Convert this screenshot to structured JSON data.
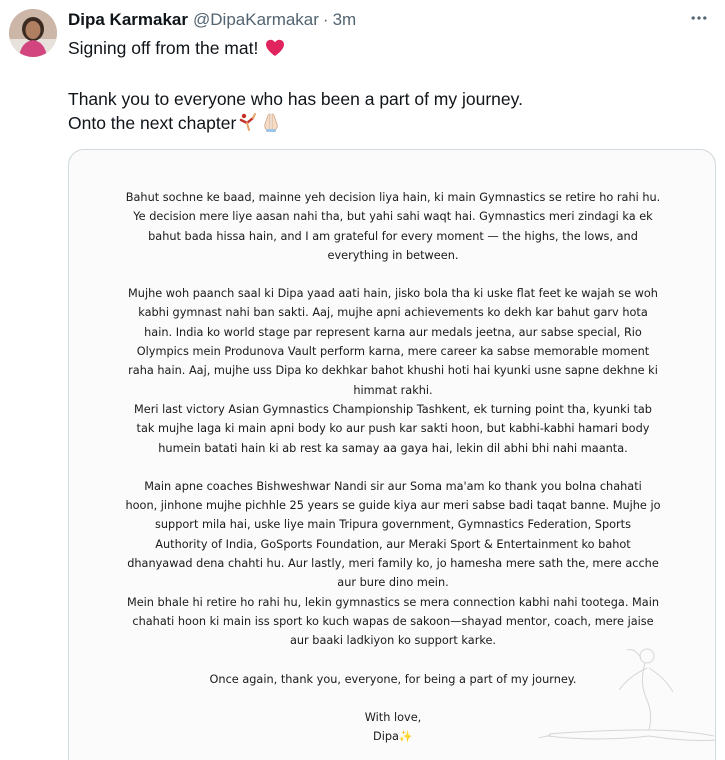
{
  "tweet": {
    "author": {
      "display_name": "Dipa Karmakar",
      "handle": "@DipaKarmakar",
      "separator": "·",
      "timestamp": "3m"
    },
    "more_icon": "ellipsis-icon",
    "text_lines": [
      "Signing off from the mat!",
      "",
      "Thank you to everyone who has been a part of my journey.",
      "Onto the next chapter"
    ],
    "emojis": {
      "heart": "❤️",
      "gymnast": "🤸",
      "folded_hands": "🙏🏻"
    },
    "colors": {
      "name": "#0f1419",
      "secondary": "#536471",
      "border": "#cfd9de",
      "heart": "#e0245e"
    }
  },
  "letter": {
    "paragraphs": [
      [
        "Bahut sochne ke baad, mainne yeh decision liya hain, ki main Gymnastics se retire ho rahi hu.",
        "Ye decision mere liye aasan nahi tha, but yahi sahi waqt hai. Gymnastics meri zindagi ka ek",
        "bahut bada hissa hain, and I am grateful for every moment — the highs, the lows, and",
        "everything in between."
      ],
      [
        "Mujhe woh paanch saal ki Dipa yaad aati hain, jisko bola tha ki uske flat feet ke wajah se woh",
        "kabhi gymnast nahi ban sakti. Aaj, mujhe apni achievements ko dekh kar bahut garv hota",
        "hain. India ko world stage par represent karna aur medals jeetna, aur sabse special, Rio",
        "Olympics mein Produnova Vault perform karna, mere career ka sabse memorable moment",
        "raha hain. Aaj, mujhe uss Dipa ko dekhkar bahot khushi hoti hai kyunki usne sapne dekhne ki",
        "himmat rakhi.",
        "Meri last victory Asian Gymnastics Championship Tashkent, ek turning point tha, kyunki tab",
        "tak mujhe laga ki main apni body ko aur push kar sakti hoon, but kabhi-kabhi hamari body",
        "humein batati hain ki ab rest ka samay aa gaya hai, lekin dil abhi bhi nahi maanta."
      ],
      [
        "Main apne coaches Bishweshwar Nandi sir aur Soma ma'am ko thank you bolna chahati",
        "hoon, jinhone mujhe pichhle 25 years se guide kiya aur meri sabse badi taqat banne. Mujhe jo",
        "support mila hai, uske liye main Tripura government, Gymnastics Federation, Sports",
        "Authority of India, GoSports Foundation, aur Meraki Sport & Entertainment ko bahot",
        "dhanyawad dena chahti hu. Aur lastly, meri family ko, jo hamesha mere sath the, mere acche",
        "aur bure dino mein.",
        "Mein bhale hi retire ho rahi hu, lekin gymnastics se mera connection kabhi nahi tootega. Main",
        "chahati hoon ki main iss sport ko kuch wapas de sakoon—shayad mentor, coach, mere jaise",
        "aur baaki ladkiyon ko support karke."
      ],
      [
        "Once again, thank you, everyone, for being a part of my journey."
      ],
      [
        "With love,",
        "Dipa✨"
      ]
    ]
  }
}
